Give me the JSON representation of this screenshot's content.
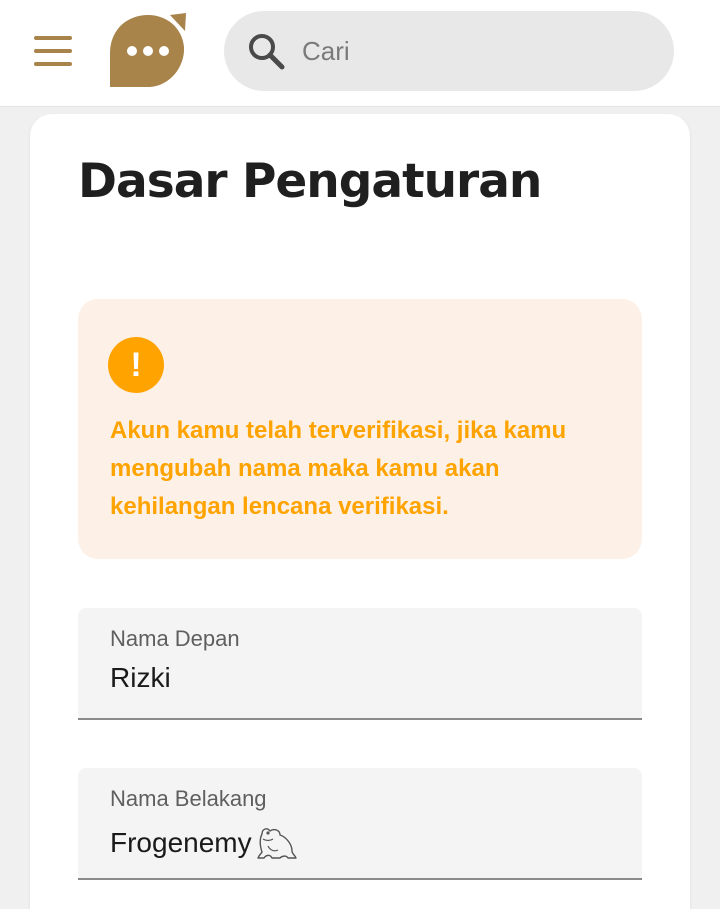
{
  "header": {
    "search_placeholder": "Cari",
    "icons": {
      "menu": "hamburger-menu-icon",
      "logo": "chat-bubble-logo",
      "search": "search-icon"
    },
    "accent_color": "#a8834a"
  },
  "settings": {
    "title": "Dasar Pengaturan",
    "alert": {
      "icon": "exclamation-icon",
      "message": "Akun kamu telah terverifikasi, jika kamu mengubah nama maka kamu akan kehilangan lencana verifikasi.",
      "color": "#ffa300",
      "background": "#fdf1e7"
    },
    "first_name": {
      "label": "Nama Depan",
      "value": "Rizki"
    },
    "last_name": {
      "label": "Nama Belakang",
      "value": "Frogenemy",
      "emoji_icon": "frog-icon"
    }
  }
}
